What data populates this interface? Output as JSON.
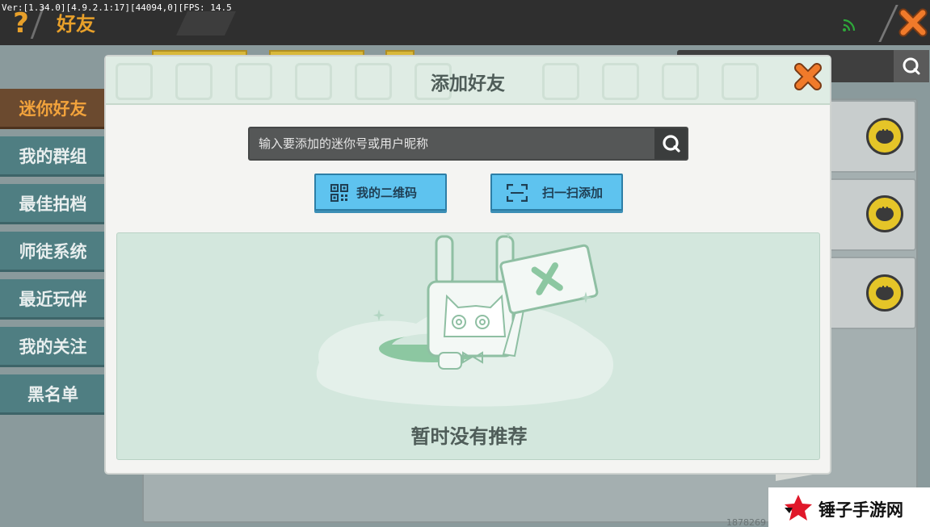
{
  "debug_text": "Ver:[1.34.0][4.9.2.1:17][44094,0][FPS: 14.5",
  "header": {
    "title": "好友"
  },
  "sidebar": {
    "items": [
      {
        "label": "迷你好友",
        "active": true
      },
      {
        "label": "我的群组"
      },
      {
        "label": "最佳拍档"
      },
      {
        "label": "师徒系统"
      },
      {
        "label": "最近玩伴"
      },
      {
        "label": "我的关注"
      },
      {
        "label": "黑名单"
      }
    ]
  },
  "background": {
    "id_text": "1878269"
  },
  "dialog": {
    "title": "添加好友",
    "search_placeholder": "输入要添加的迷你号或用户昵称",
    "qr_button_label": "我的二维码",
    "scan_button_label": "扫一扫添加",
    "empty_text": "暂时没有推荐"
  },
  "watermark": {
    "text": "锤子手游网"
  },
  "colors": {
    "accent_orange": "#e8a02a",
    "sidebar_teal": "#4f7e82",
    "button_blue": "#5ec3ef",
    "recommend_green": "#d3e7dd",
    "close_orange": "#f07a2a"
  }
}
